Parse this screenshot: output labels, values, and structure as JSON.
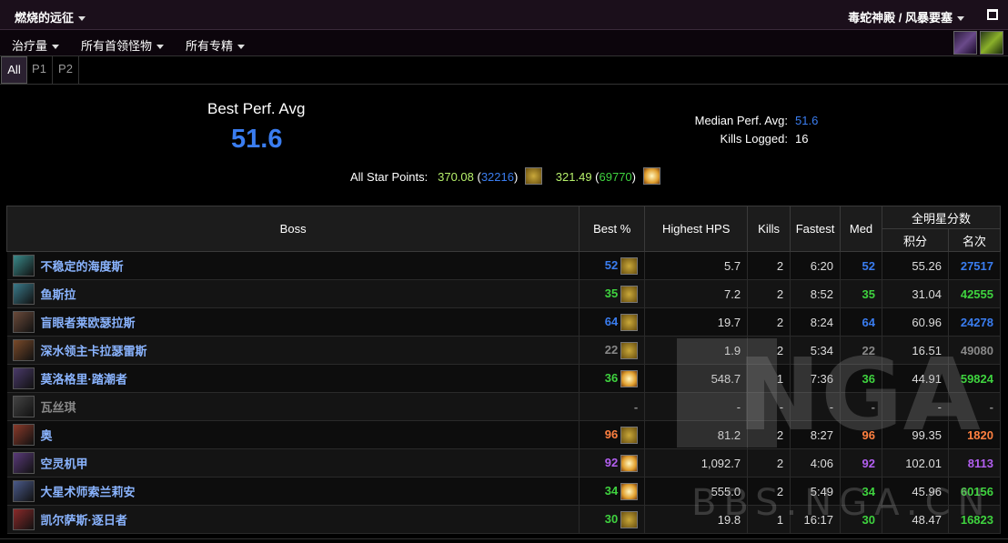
{
  "header": {
    "title": "燃烧的远征",
    "zone": "毒蛇神殿 / 风暴要塞"
  },
  "filters": {
    "metric": "治疗量",
    "bosses": "所有首领怪物",
    "specs": "所有专精"
  },
  "tabs": [
    {
      "label": "All",
      "active": true
    },
    {
      "label": "P1",
      "active": false
    },
    {
      "label": "P2",
      "active": false
    }
  ],
  "summary": {
    "best_label": "Best Perf. Avg",
    "best_value": "51.6",
    "median_label": "Median Perf. Avg:",
    "median_value": "51.6",
    "kills_label": "Kills Logged:",
    "kills_value": "16",
    "stars_label": "All Star Points:",
    "stars_1_pts": "370.08",
    "stars_1_rank": "32216",
    "stars_2_pts": "321.49",
    "stars_2_rank": "69770"
  },
  "table": {
    "headers": {
      "boss": "Boss",
      "best": "Best %",
      "hps": "Highest HPS",
      "kills": "Kills",
      "fastest": "Fastest",
      "med": "Med",
      "allstar": "全明星分数",
      "points": "积分",
      "rank": "名次"
    },
    "rows": [
      {
        "name": "不稳定的海度斯",
        "best": "52",
        "best_color": "blue",
        "icon": "gold",
        "hps": "5.7",
        "kills": "2",
        "fastest": "6:20",
        "med": "52",
        "med_color": "blue",
        "points": "55.26",
        "rank": "27517",
        "rank_color": "blue",
        "icon_color": "#3a8a8a"
      },
      {
        "name": "鱼斯拉",
        "best": "35",
        "best_color": "green",
        "icon": "gold",
        "hps": "7.2",
        "kills": "2",
        "fastest": "8:52",
        "med": "35",
        "med_color": "green",
        "points": "31.04",
        "rank": "42555",
        "rank_color": "green",
        "icon_color": "#3a7a8a"
      },
      {
        "name": "盲眼者莱欧瑟拉斯",
        "best": "64",
        "best_color": "blue",
        "icon": "gold",
        "hps": "19.7",
        "kills": "2",
        "fastest": "8:24",
        "med": "64",
        "med_color": "blue",
        "points": "60.96",
        "rank": "24278",
        "rank_color": "blue",
        "icon_color": "#6a4a3a"
      },
      {
        "name": "深水领主卡拉瑟雷斯",
        "best": "22",
        "best_color": "gray",
        "icon": "gold",
        "hps": "1.9",
        "kills": "2",
        "fastest": "5:34",
        "med": "22",
        "med_color": "gray",
        "points": "16.51",
        "rank": "49080",
        "rank_color": "gray",
        "icon_color": "#7a4a2a"
      },
      {
        "name": "莫洛格里·踏潮者",
        "best": "36",
        "best_color": "green",
        "icon": "sun",
        "hps": "548.7",
        "kills": "1",
        "fastest": "7:36",
        "med": "36",
        "med_color": "green",
        "points": "44.91",
        "rank": "59824",
        "rank_color": "green",
        "icon_color": "#4a3a6a"
      },
      {
        "name": "瓦丝琪",
        "best": "-",
        "best_color": "gray",
        "icon": "none",
        "hps": "-",
        "kills": "-",
        "fastest": "-",
        "med": "-",
        "med_color": "gray",
        "points": "-",
        "rank": "-",
        "rank_color": "gray",
        "icon_color": "#444444",
        "dim": true
      },
      {
        "name": "奥",
        "best": "96",
        "best_color": "orange",
        "icon": "gold",
        "hps": "81.2",
        "kills": "2",
        "fastest": "8:27",
        "med": "96",
        "med_color": "orange",
        "points": "99.35",
        "rank": "1820",
        "rank_color": "orange",
        "icon_color": "#8a3a2a"
      },
      {
        "name": "空灵机甲",
        "best": "92",
        "best_color": "purple",
        "icon": "sun",
        "hps": "1,092.7",
        "kills": "2",
        "fastest": "4:06",
        "med": "92",
        "med_color": "purple",
        "points": "102.01",
        "rank": "8113",
        "rank_color": "purple",
        "icon_color": "#5a3a7a"
      },
      {
        "name": "大星术师索兰莉安",
        "best": "34",
        "best_color": "green",
        "icon": "sun",
        "hps": "555.0",
        "kills": "2",
        "fastest": "5:49",
        "med": "34",
        "med_color": "green",
        "points": "45.96",
        "rank": "60156",
        "rank_color": "green",
        "icon_color": "#4a5a8a"
      },
      {
        "name": "凯尔萨斯·逐日者",
        "best": "30",
        "best_color": "green",
        "icon": "gold",
        "hps": "19.8",
        "kills": "1",
        "fastest": "16:17",
        "med": "30",
        "med_color": "green",
        "points": "48.47",
        "rank": "16823",
        "rank_color": "green",
        "icon_color": "#8a2a2a"
      }
    ]
  },
  "watermark": {
    "logo": "NGA",
    "text": "BBS.NGA.CN"
  },
  "colors": {
    "blue": "#3a7df0",
    "green": "#3fd33f",
    "purple": "#b25ff0",
    "orange": "#ff8040",
    "gray": "#888888"
  }
}
